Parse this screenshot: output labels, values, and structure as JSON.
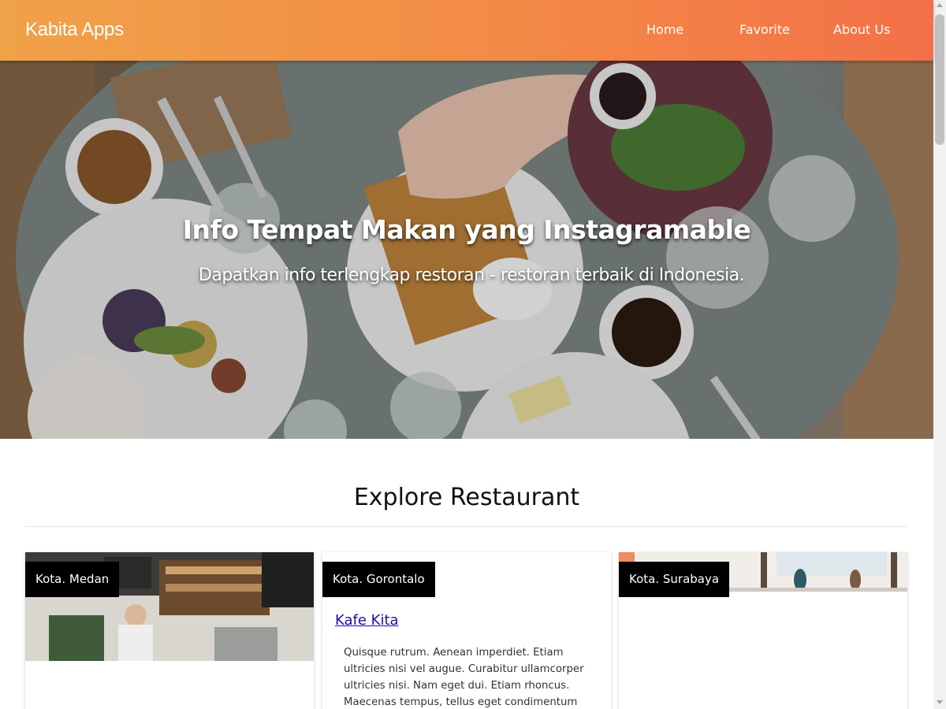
{
  "header": {
    "brand": "Kabita Apps",
    "nav": [
      "Home",
      "Favorite",
      "About Us"
    ],
    "gradient": [
      "#f0a248",
      "#f37048"
    ]
  },
  "hero": {
    "title": "Info Tempat Makan yang Instagramable",
    "subtitle": "Dapatkan info terlengkap restoran - restoran terbaik di Indonesia."
  },
  "explore": {
    "title": "Explore Restaurant",
    "cards": [
      {
        "city": "Kota. Medan",
        "image": "coffee-shop-photo"
      },
      {
        "city": "Kota. Gorontalo",
        "name": "Kafe Kita",
        "description": "Quisque rutrum. Aenean imperdiet. Etiam ultricies nisi vel augue. Curabitur ullamcorper ultricies nisi. Nam eget dui. Etiam rhoncus. Maecenas tempus, tellus eget condimentum"
      },
      {
        "city": "Kota. Surabaya",
        "image": "restaurant-interior-photo"
      }
    ]
  }
}
